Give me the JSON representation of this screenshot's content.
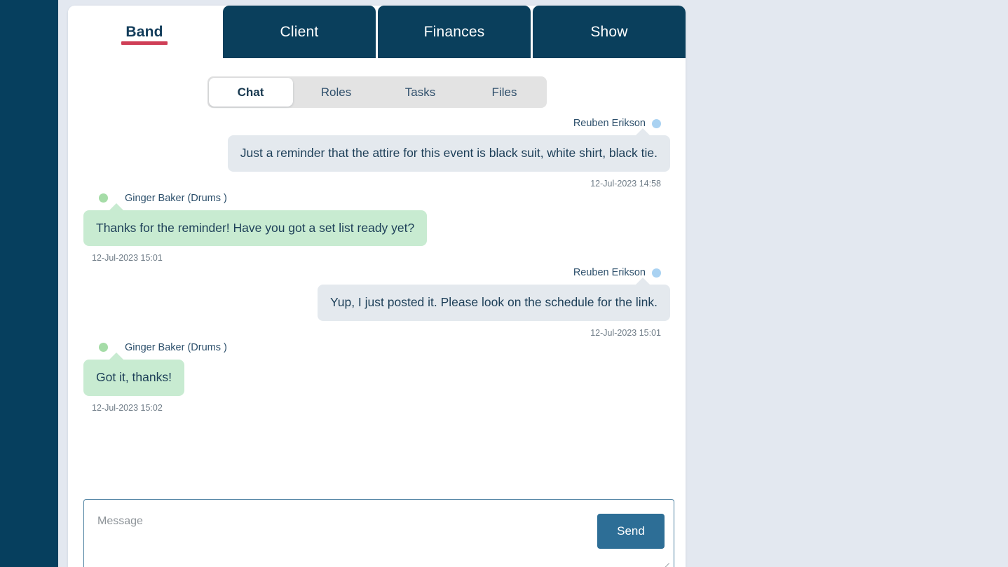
{
  "theme": {
    "rail_color": "#063f5e",
    "page_background": "#e3e8f0",
    "tab_active_underline": "#cf3e56",
    "tab_inactive_bg": "#0a3f5c",
    "send_button_color": "#2d6e96",
    "bubble_incoming_color": "#c8ebd1",
    "bubble_outgoing_color": "#e4e9ee",
    "status_dot_blue": "#a9d2f2",
    "status_dot_green": "#a5dca7"
  },
  "main_tabs": [
    {
      "label": "Band",
      "active": true
    },
    {
      "label": "Client",
      "active": false
    },
    {
      "label": "Finances",
      "active": false
    },
    {
      "label": "Show",
      "active": false
    }
  ],
  "sub_tabs": [
    {
      "label": "Chat",
      "active": true
    },
    {
      "label": "Roles",
      "active": false
    },
    {
      "label": "Tasks",
      "active": false
    },
    {
      "label": "Files",
      "active": false
    }
  ],
  "messages": [
    {
      "sender": "Reuben Erikson",
      "side": "right",
      "status": "blue",
      "text": "Just a reminder that the attire for this event is black suit, white shirt, black tie.",
      "time": "12-Jul-2023 14:58"
    },
    {
      "sender": "Ginger Baker (Drums )",
      "side": "left",
      "status": "green",
      "text": "Thanks for the reminder! Have you got a set list ready yet?",
      "time": "12-Jul-2023 15:01"
    },
    {
      "sender": "Reuben Erikson",
      "side": "right",
      "status": "blue",
      "text": "Yup, I just posted it. Please look on the schedule for the link.",
      "time": "12-Jul-2023 15:01"
    },
    {
      "sender": "Ginger Baker (Drums )",
      "side": "left",
      "status": "green",
      "text": "Got it, thanks!",
      "time": "12-Jul-2023 15:02"
    }
  ],
  "composer": {
    "placeholder": "Message",
    "value": "",
    "send_label": "Send"
  }
}
